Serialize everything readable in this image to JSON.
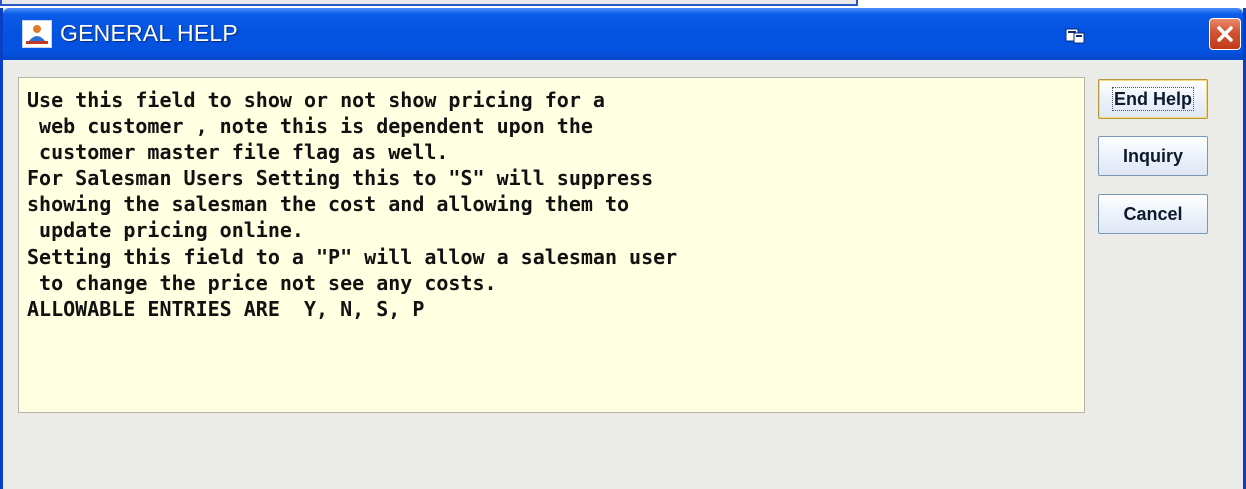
{
  "window": {
    "title": "GENERAL HELP"
  },
  "icons": {
    "app": "app-logo-icon",
    "system_menu": "window-menu-icon",
    "close": "close-icon"
  },
  "colors": {
    "titlebar": "#0352e0",
    "help_background": "#ffffe1",
    "close_button": "#d1532f"
  },
  "help": {
    "lines": [
      "Use this field to show or not show pricing for a",
      " web customer , note this is dependent upon the",
      " customer master file flag as well.",
      "For Salesman Users Setting this to \"S\" will suppress",
      "showing the salesman the cost and allowing them to",
      " update pricing online.",
      "Setting this field to a \"P\" will allow a salesman user",
      " to change the price not see any costs.",
      "ALLOWABLE ENTRIES ARE  Y, N, S, P"
    ]
  },
  "buttons": {
    "end_help": "End Help",
    "inquiry": "Inquiry",
    "cancel": "Cancel"
  }
}
